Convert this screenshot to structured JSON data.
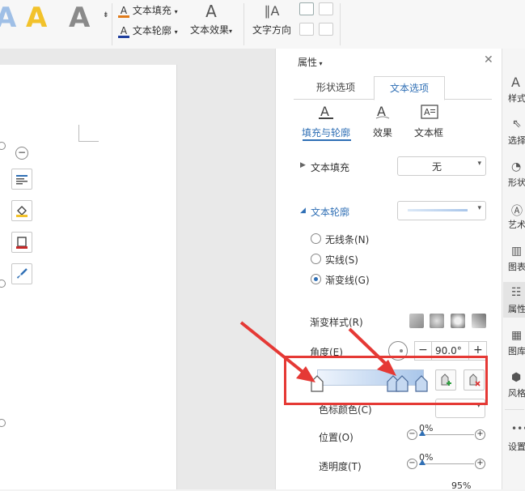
{
  "ribbon": {
    "big_a_label": "A",
    "text_fill_label": "文本填充",
    "text_outline_label": "文本轮廓",
    "text_effects_label": "文本效果",
    "text_direction_label": "文字方向"
  },
  "panel": {
    "title": "属性",
    "tabs": [
      {
        "label": "形状选项"
      },
      {
        "label": "文本选项"
      }
    ],
    "subtabs": [
      {
        "label": "填充与轮廓"
      },
      {
        "label": "效果"
      },
      {
        "label": "文本框"
      }
    ],
    "text_fill": {
      "label": "文本填充",
      "value": "无"
    },
    "text_outline": {
      "label": "文本轮廓"
    },
    "line_options": [
      {
        "label": "无线条(N)",
        "selected": false
      },
      {
        "label": "实线(S)",
        "selected": false
      },
      {
        "label": "渐变线(G)",
        "selected": true
      }
    ],
    "gradient_style": {
      "label": "渐变样式(R)"
    },
    "angle": {
      "label": "角度(E)",
      "value": "90.0°",
      "minus": "−",
      "plus": "+"
    },
    "stop_color": {
      "label": "色标颜色(C)"
    },
    "position": {
      "label": "位置(O)",
      "value": "0%"
    },
    "transparency": {
      "label": "透明度(T)",
      "value": "0%"
    },
    "brightness": {
      "value": "95%"
    }
  },
  "right_sidebar": {
    "items": [
      {
        "label": "样式"
      },
      {
        "label": "选择"
      },
      {
        "label": "形状"
      },
      {
        "label": "艺术字"
      },
      {
        "label": "图表"
      },
      {
        "label": "属性"
      },
      {
        "label": "图库"
      },
      {
        "label": "风格"
      },
      {
        "label": "设置"
      }
    ]
  },
  "colors": {
    "accent": "#2f6fb5",
    "highlight": "#e53935",
    "gold": "#f2c22b",
    "gradient_start": "#dbe8f7",
    "gradient_end": "#a9c6ea"
  },
  "icons": {
    "close": "close-icon",
    "collapse": "minus-icon"
  }
}
